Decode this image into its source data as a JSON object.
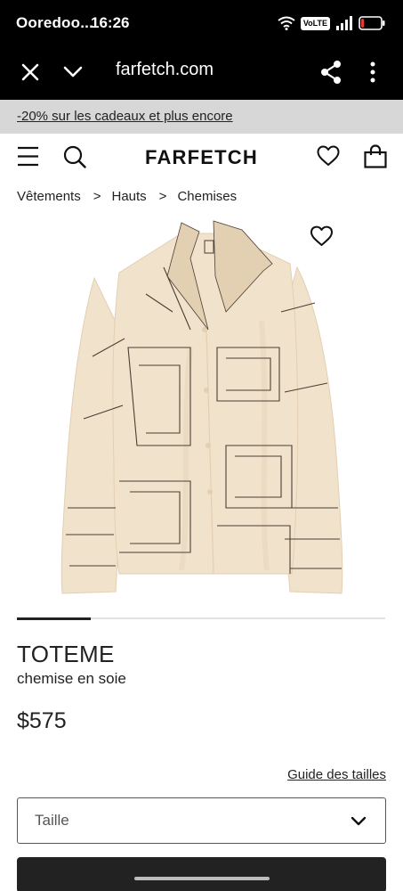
{
  "status_bar": {
    "carrier": "Ooredoo...",
    "time": "16:26",
    "volte": "VoLTE",
    "battery_level": 0.15
  },
  "browser": {
    "url": "farfetch.com"
  },
  "promo": {
    "text": "-20% sur les cadeaux et plus encore"
  },
  "header": {
    "logo": "FARFETCH"
  },
  "breadcrumb": {
    "items": [
      "Vêtements",
      "Hauts",
      "Chemises"
    ],
    "separator": ">"
  },
  "gallery": {
    "progress": 0.2
  },
  "product": {
    "brand": "TOTEME",
    "name": "chemise en soie",
    "price": "$575"
  },
  "size": {
    "guide_label": "Guide des tailles",
    "select_placeholder": "Taille"
  },
  "colors": {
    "shirt": "#f1e2cc",
    "shirt_shade": "#e3cfb2",
    "print_line": "#4a3f34"
  }
}
